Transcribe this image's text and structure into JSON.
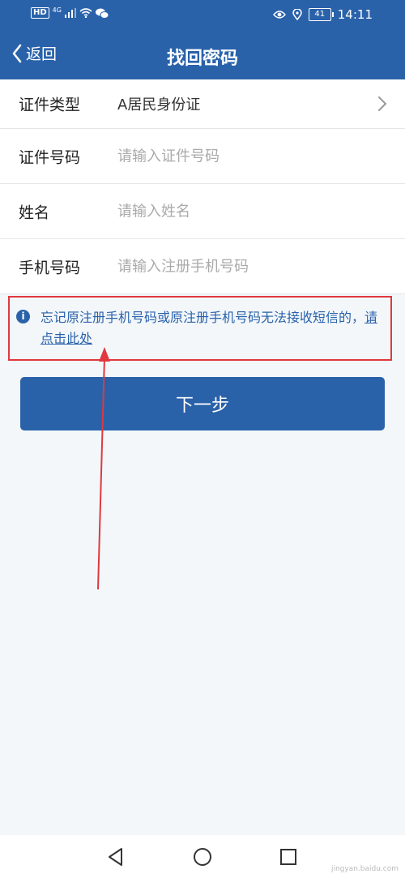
{
  "status_bar": {
    "hd": "HD",
    "network": "4G",
    "battery": "41",
    "time": "14:11"
  },
  "nav": {
    "back_label": "返回",
    "title": "找回密码"
  },
  "form": {
    "rows": [
      {
        "label": "证件类型",
        "value": "A居民身份证"
      },
      {
        "label": "证件号码",
        "placeholder": "请输入证件号码"
      },
      {
        "label": "姓名",
        "placeholder": "请输入姓名"
      },
      {
        "label": "手机号码",
        "placeholder": "请输入注册手机号码"
      }
    ]
  },
  "notice": {
    "icon": "i",
    "text": "忘记原注册手机号码或原注册手机号码无法接收短信的，",
    "link": "请点击此处"
  },
  "next_button": {
    "label": "下一步"
  },
  "annotation": {
    "color": "#e0383e"
  },
  "watermark": "jingyan.baidu.com",
  "colors": {
    "primary": "#2a62aa",
    "background": "#f3f7fa",
    "accent": "#e0383e"
  }
}
